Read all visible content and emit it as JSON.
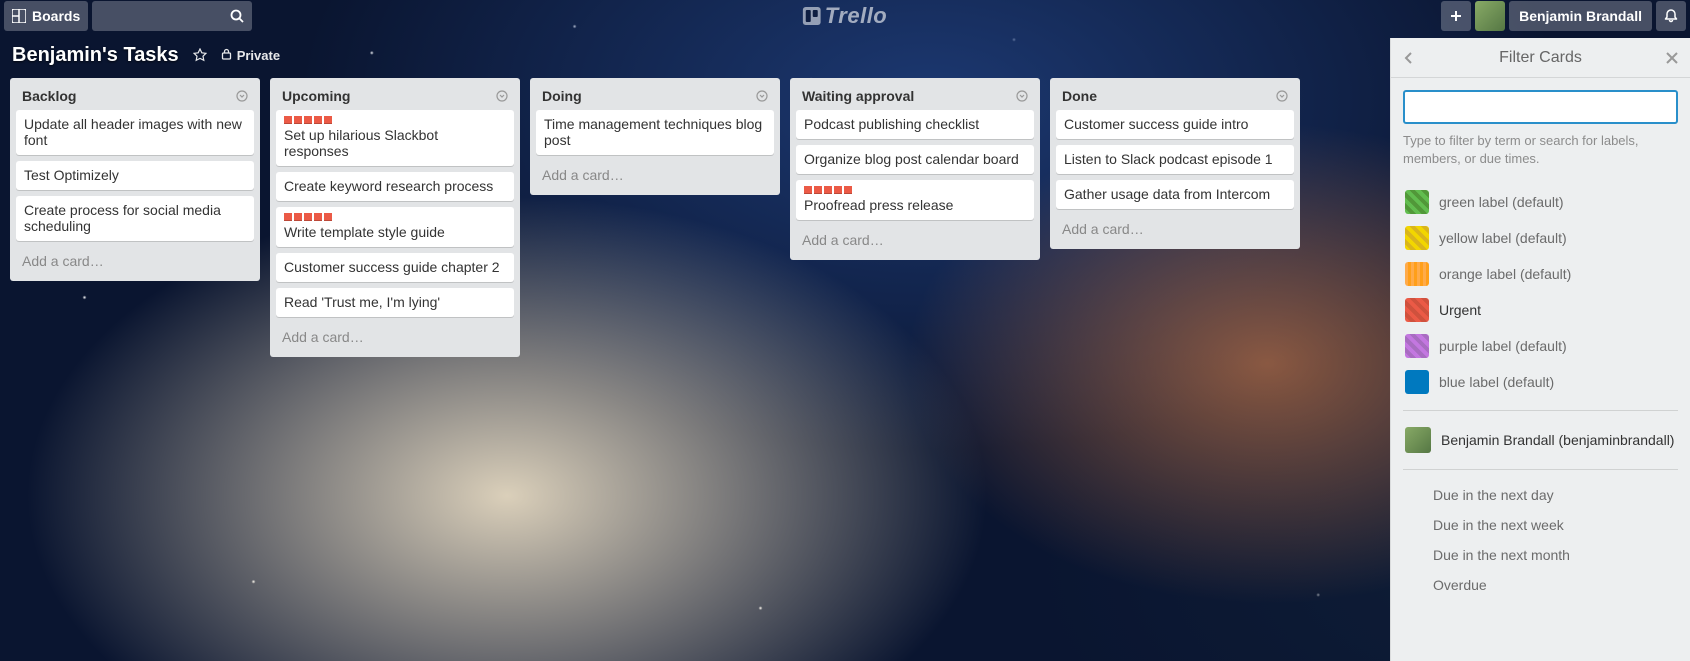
{
  "topbar": {
    "boards_label": "Boards",
    "logo_text": "Trello",
    "user_name": "Benjamin Brandall"
  },
  "board": {
    "title": "Benjamin's Tasks",
    "privacy": "Private"
  },
  "lists": [
    {
      "title": "Backlog",
      "add": "Add a card…",
      "cards": [
        {
          "text": "Update all header images with new font"
        },
        {
          "text": "Test Optimizely"
        },
        {
          "text": "Create process for social media scheduling"
        }
      ]
    },
    {
      "title": "Upcoming",
      "add": "Add a card…",
      "cards": [
        {
          "text": "Set up hilarious Slackbot responses",
          "urgent": true
        },
        {
          "text": "Create keyword research process"
        },
        {
          "text": "Write template style guide",
          "urgent": true
        },
        {
          "text": "Customer success guide chapter 2"
        },
        {
          "text": "Read 'Trust me, I'm lying'"
        }
      ]
    },
    {
      "title": "Doing",
      "add": "Add a card…",
      "cards": [
        {
          "text": "Time management techniques blog post"
        }
      ]
    },
    {
      "title": "Waiting approval",
      "add": "Add a card…",
      "cards": [
        {
          "text": "Podcast publishing checklist"
        },
        {
          "text": "Organize blog post calendar board"
        },
        {
          "text": "Proofread press release",
          "urgent": true
        }
      ]
    },
    {
      "title": "Done",
      "add": "Add a card…",
      "cards": [
        {
          "text": "Customer success guide intro"
        },
        {
          "text": "Listen to Slack podcast episode 1"
        },
        {
          "text": "Gather usage data from Intercom"
        }
      ]
    }
  ],
  "filter": {
    "title": "Filter Cards",
    "hint": "Type to filter by term or search for labels, members, or due times.",
    "search_value": "",
    "labels": [
      {
        "name": "green label (default)",
        "swatch": "sw-green"
      },
      {
        "name": "yellow label (default)",
        "swatch": "sw-yellow"
      },
      {
        "name": "orange label (default)",
        "swatch": "sw-orange"
      },
      {
        "name": "Urgent",
        "swatch": "sw-red",
        "strong": true
      },
      {
        "name": "purple label (default)",
        "swatch": "sw-purple"
      },
      {
        "name": "blue label (default)",
        "swatch": "sw-blue"
      }
    ],
    "member": "Benjamin Brandall (benjaminbrandall)",
    "due": [
      "Due in the next day",
      "Due in the next week",
      "Due in the next month",
      "Overdue"
    ]
  }
}
